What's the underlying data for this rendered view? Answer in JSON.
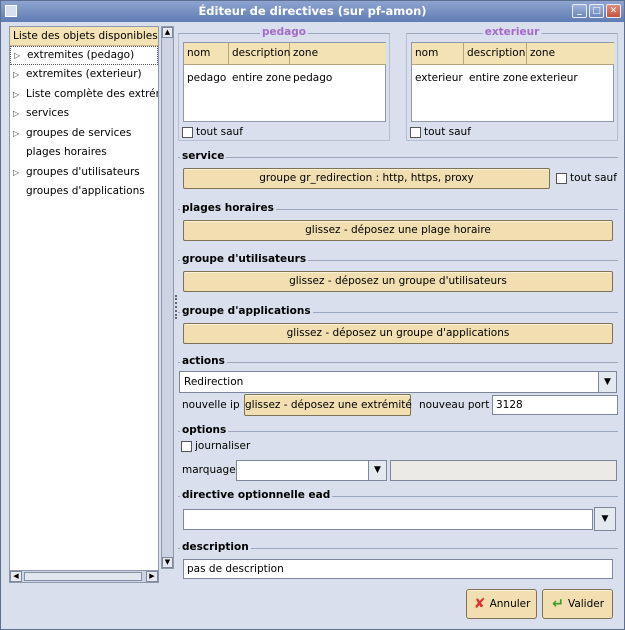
{
  "window": {
    "title": "Éditeur de directives (sur pf-amon)",
    "buttons": [
      "_",
      "□",
      "✕"
    ]
  },
  "left_panel": {
    "header": "Liste des objets disponibles",
    "items": [
      {
        "label": "extremites (pedago)",
        "expandable": true,
        "selected": true
      },
      {
        "label": "extremites (exterieur)",
        "expandable": true
      },
      {
        "label": "Liste complète des extrémités",
        "expandable": true
      },
      {
        "label": "services",
        "expandable": true
      },
      {
        "label": "groupes de services",
        "expandable": true
      },
      {
        "label": "plages horaires",
        "expandable": false
      },
      {
        "label": "groupes d'utilisateurs",
        "expandable": true
      },
      {
        "label": "groupes d'applications",
        "expandable": false
      }
    ]
  },
  "pedago": {
    "legend": "pedago",
    "cols": [
      "nom",
      "description",
      "zone"
    ],
    "row": [
      "pedago",
      "entire zone",
      "pedago"
    ],
    "tout_sauf": "tout sauf"
  },
  "exterieur": {
    "legend": "exterieur",
    "cols": [
      "nom",
      "description",
      "zone"
    ],
    "row": [
      "exterieur",
      "entire zone",
      "exterieur"
    ],
    "tout_sauf": "tout sauf"
  },
  "service": {
    "legend": "service",
    "button": "groupe gr_redirection : http, https, proxy",
    "tout_sauf": "tout sauf"
  },
  "plages": {
    "legend": "plages horaires",
    "button": "glissez - déposez une plage horaire"
  },
  "groupe_utilisateurs": {
    "legend": "groupe d'utilisateurs",
    "button": "glissez - déposez un groupe d'utilisateurs"
  },
  "groupe_applications": {
    "legend": "groupe d'applications",
    "button": "glissez - déposez un groupe d'applications"
  },
  "actions": {
    "legend": "actions",
    "selected": "Redirection",
    "nouvelle_ip_label": "nouvelle ip",
    "ip_button": "glissez - déposez une extrémité",
    "port_label": "nouveau port",
    "port_value": "3128"
  },
  "options": {
    "legend": "options",
    "journaliser": "journaliser",
    "marquage_label": "marquage",
    "marquage_value": ""
  },
  "directive_ead": {
    "legend": "directive optionnelle ead",
    "value": ""
  },
  "description": {
    "legend": "description",
    "value": "pas de description"
  },
  "footer": {
    "annuler": "Annuler",
    "valider": "Valider"
  },
  "colors": {
    "accent_legend": "#a46acb",
    "button_bg": "#f1dfb1",
    "panel_bg": "#d9dfec"
  }
}
